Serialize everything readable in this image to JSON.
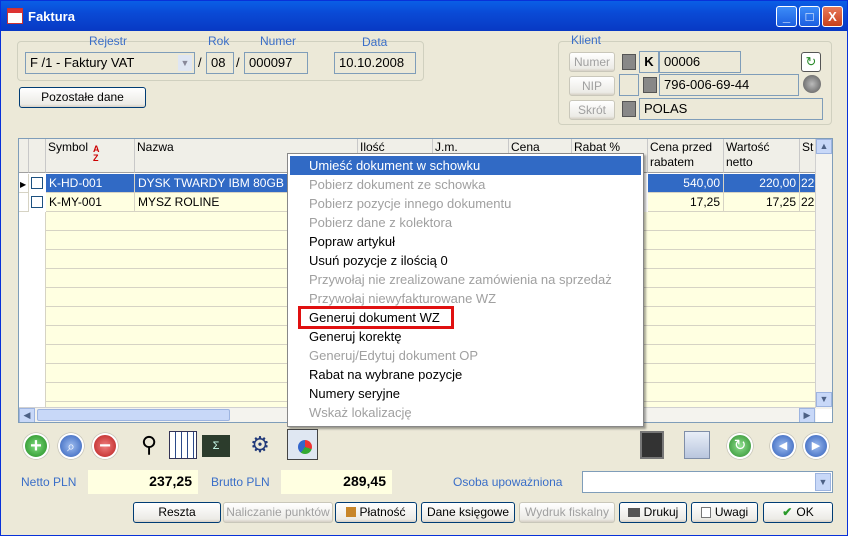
{
  "window": {
    "title": "Faktura",
    "min": "_",
    "max": "□",
    "close": "X"
  },
  "header": {
    "rejestr_label": "Rejestr",
    "rok_label": "Rok",
    "numer_label": "Numer",
    "data_label": "Data",
    "rejestr_value": "F /1  - Faktury VAT",
    "rok_value": "08",
    "numer_value": "000097",
    "data_value": "10.10.2008",
    "sep1": "/",
    "sep2": "/",
    "pozostale_button": "Pozostałe dane"
  },
  "klient": {
    "label": "Klient",
    "numer_btn": "Numer",
    "nip_btn": "NIP",
    "skrot_btn": "Skrót",
    "k_badge": "K",
    "numer_value": "00006",
    "nip_value": "796-006-69-44",
    "skrot_value": "POLAS"
  },
  "grid": {
    "columns": [
      "Symbol",
      "Nazwa",
      "Ilość",
      "J.m.",
      "Cena",
      "Rabat %",
      "Cena przed rabatem",
      "Wartość netto",
      "St"
    ],
    "rows": [
      {
        "symbol": "K-HD-001",
        "nazwa": "DYSK TWARDY IBM 80GB",
        "cena_przed": "540,00",
        "wartosc": "220,00",
        "st": "22"
      },
      {
        "symbol": "K-MY-001",
        "nazwa": "MYSZ ROLINE",
        "cena_przed": "17,25",
        "wartosc": "17,25",
        "st": "22"
      }
    ]
  },
  "context_menu": {
    "items": [
      {
        "label": "Umieść dokument w schowku",
        "state": "highlighted"
      },
      {
        "label": "Pobierz dokument ze schowka",
        "state": "disabled"
      },
      {
        "label": "Pobierz pozycje innego dokumentu",
        "state": "disabled"
      },
      {
        "label": "Pobierz dane z kolektora",
        "state": "disabled"
      },
      {
        "label": "Popraw artykuł",
        "state": "enabled"
      },
      {
        "label": "Usuń pozycje z ilością 0",
        "state": "enabled"
      },
      {
        "label": "Przywołaj nie zrealizowane zamówienia na sprzedaż",
        "state": "disabled"
      },
      {
        "label": "Przywołaj niewyfakturowane WZ",
        "state": "disabled"
      },
      {
        "label": "Generuj dokument WZ",
        "state": "enabled"
      },
      {
        "label": "Generuj korektę",
        "state": "enabled"
      },
      {
        "label": "Generuj/Edytuj dokument OP",
        "state": "disabled"
      },
      {
        "label": "Rabat na wybrane pozycje",
        "state": "enabled"
      },
      {
        "label": "Numery seryjne",
        "state": "enabled"
      },
      {
        "label": "Wskaż lokalizację",
        "state": "disabled"
      }
    ]
  },
  "summary": {
    "netto_label": "Netto PLN",
    "netto_value": "237,25",
    "brutto_label": "Brutto PLN",
    "brutto_value": "289,45",
    "osoba_label": "Osoba upoważniona",
    "osoba_value": ""
  },
  "footer_buttons": {
    "reszta": "Reszta",
    "naliczanie": "Naliczanie punktów",
    "platnosc": "Płatność",
    "dane_ksiegowe": "Dane księgowe",
    "wydruk": "Wydruk fiskalny",
    "drukuj": "Drukuj",
    "uwagi": "Uwagi",
    "ok": "OK"
  },
  "colors": {
    "accent": "#316ac5",
    "title_bar": "#0a4ad6",
    "highlight_box": "#e01010",
    "summary_bg": "#ffffe1"
  }
}
